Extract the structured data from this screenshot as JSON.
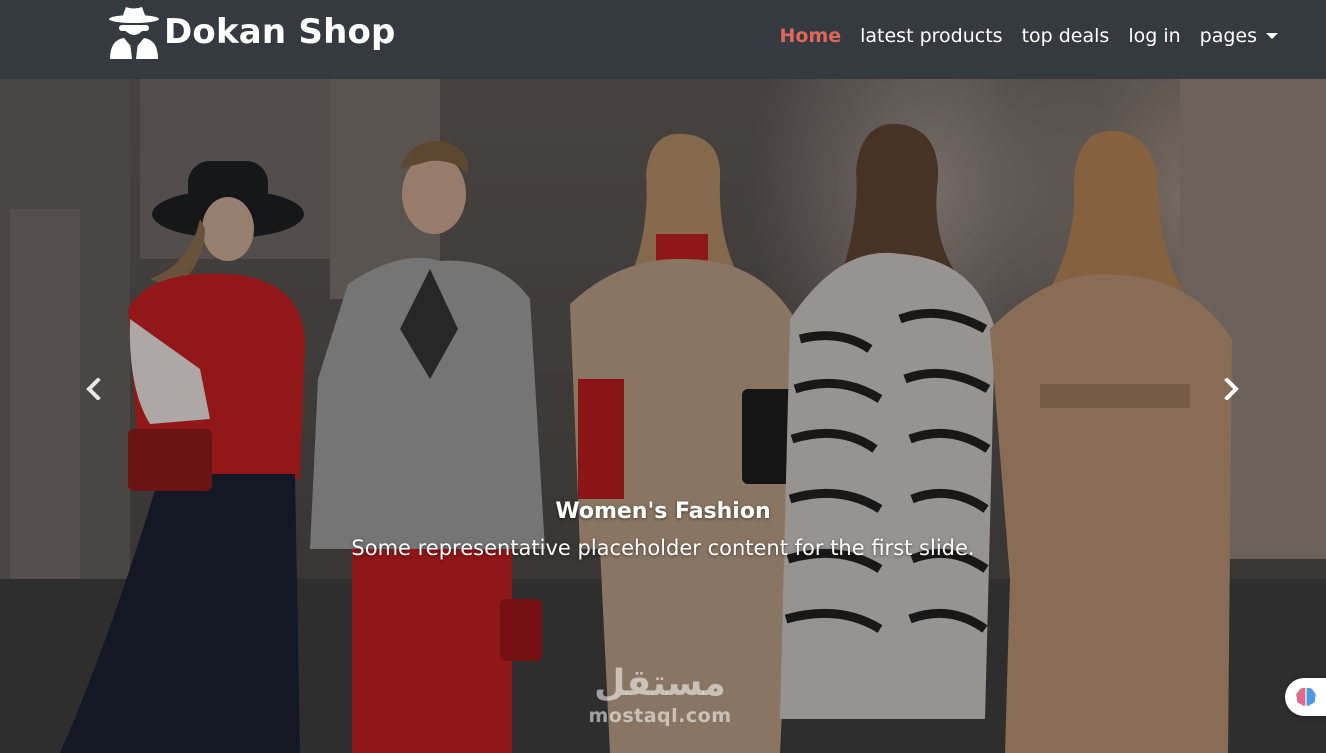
{
  "brand": {
    "name": "Dokan Shop",
    "logo_icon": "spy-icon"
  },
  "nav": {
    "items": [
      {
        "label": "Home",
        "active": true
      },
      {
        "label": "latest products",
        "active": false
      },
      {
        "label": "top deals",
        "active": false
      },
      {
        "label": "log in",
        "active": false
      },
      {
        "label": "pages",
        "active": false,
        "dropdown": true
      }
    ]
  },
  "carousel": {
    "slide": {
      "title": "Women's Fashion",
      "text": "Some representative placeholder content for the first slide."
    },
    "prev_icon": "chevron-left-icon",
    "next_icon": "chevron-right-icon"
  },
  "watermark": {
    "arabic": "مستقل",
    "latin": "mostaql.com"
  },
  "chat_widget": {
    "icon": "brain-icon"
  },
  "colors": {
    "navbar": "#343a40",
    "active_link": "#e0675c",
    "text": "#ffffff"
  }
}
